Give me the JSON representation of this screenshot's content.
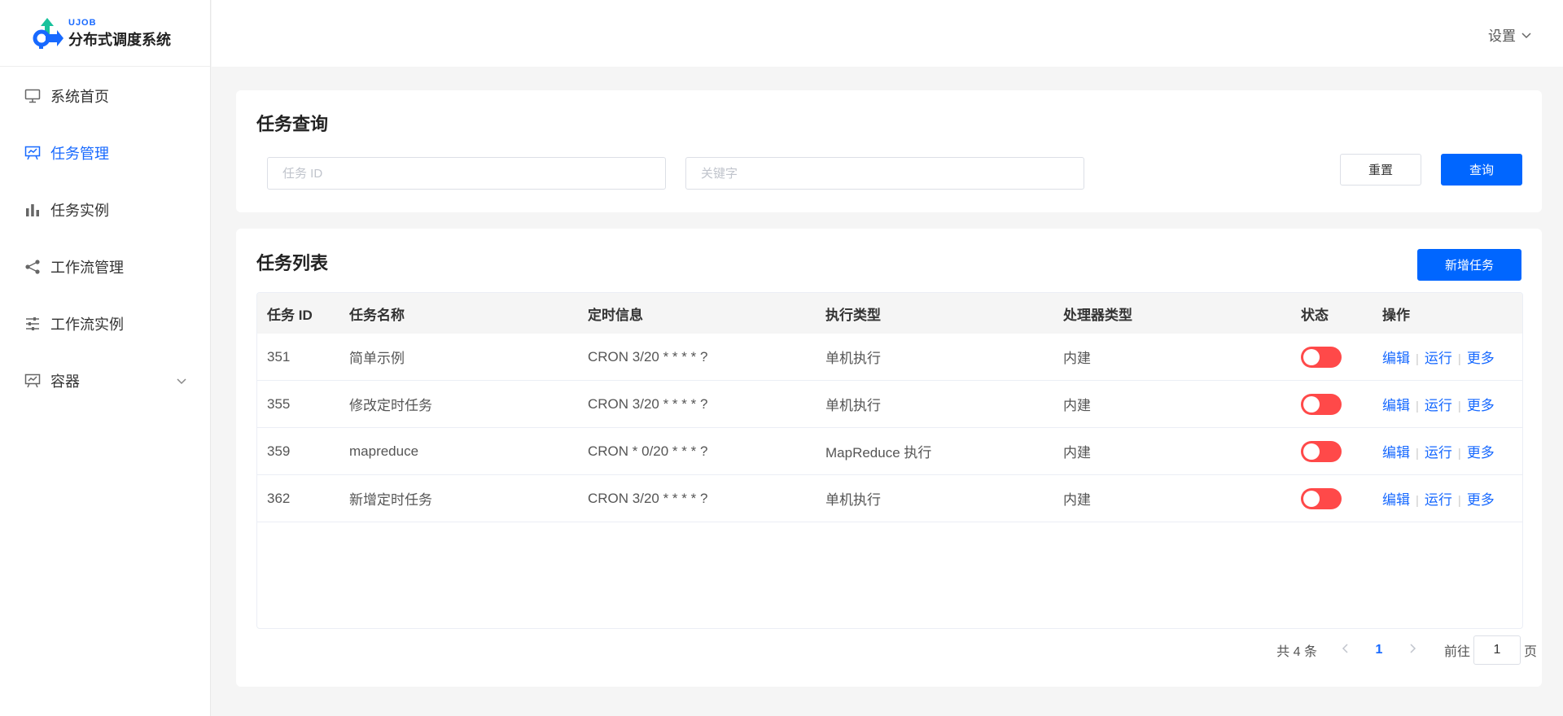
{
  "brand": {
    "small": "UJOB",
    "name": "分布式调度系统"
  },
  "header": {
    "settings_label": "设置"
  },
  "sidebar": {
    "items": [
      {
        "label": "系统首页",
        "icon": "monitor-icon",
        "active": false
      },
      {
        "label": "任务管理",
        "icon": "presentation-icon",
        "active": true
      },
      {
        "label": "任务实例",
        "icon": "bar-chart-icon",
        "active": false
      },
      {
        "label": "工作流管理",
        "icon": "share-icon",
        "active": false
      },
      {
        "label": "工作流实例",
        "icon": "sliders-icon",
        "active": false
      },
      {
        "label": "容器",
        "icon": "easel-icon",
        "active": false,
        "expandable": true
      }
    ]
  },
  "query": {
    "title": "任务查询",
    "id_placeholder": "任务 ID",
    "keyword_placeholder": "关键字",
    "reset_label": "重置",
    "search_label": "查询"
  },
  "list": {
    "title": "任务列表",
    "add_label": "新增任务",
    "columns": [
      "任务 ID",
      "任务名称",
      "定时信息",
      "执行类型",
      "处理器类型",
      "状态",
      "操作"
    ],
    "rows": [
      {
        "id": "351",
        "name": "简单示例",
        "schedule": "CRON 3/20 * * * * ?",
        "exec": "单机执行",
        "processor": "内建",
        "enabled": false
      },
      {
        "id": "355",
        "name": "修改定时任务",
        "schedule": "CRON 3/20 * * * * ?",
        "exec": "单机执行",
        "processor": "内建",
        "enabled": false
      },
      {
        "id": "359",
        "name": "mapreduce",
        "schedule": "CRON * 0/20 * * * ?",
        "exec": "MapReduce 执行",
        "processor": "内建",
        "enabled": false
      },
      {
        "id": "362",
        "name": "新增定时任务",
        "schedule": "CRON 3/20 * * * * ?",
        "exec": "单机执行",
        "processor": "内建",
        "enabled": false
      }
    ],
    "actions": {
      "edit": "编辑",
      "run": "运行",
      "more": "更多"
    }
  },
  "pagination": {
    "total": "共 4 条",
    "current": "1",
    "goto_prefix": "前往",
    "goto_value": "1",
    "goto_suffix": "页"
  },
  "colors": {
    "primary": "#0066ff",
    "accent": "#1769ff",
    "toggle_off": "#ff4949"
  }
}
